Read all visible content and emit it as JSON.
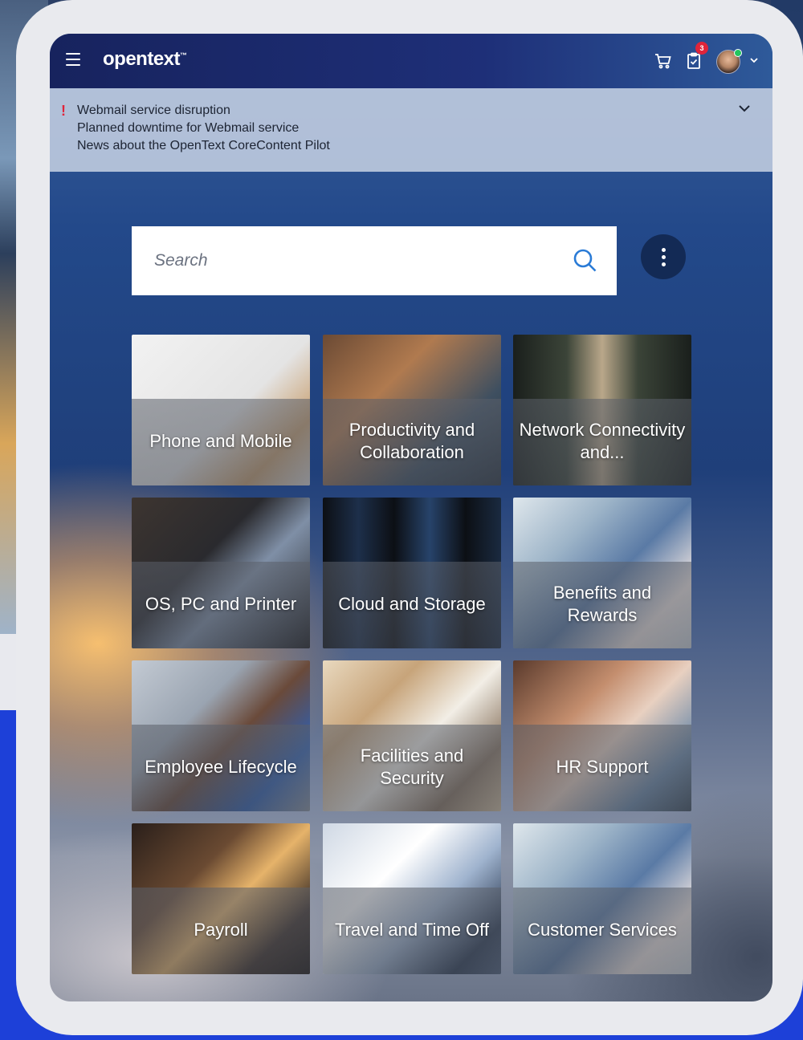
{
  "header": {
    "brand": "opentext",
    "brand_mark": "™",
    "cart_icon": "cart-icon",
    "tasks_icon": "clipboard-check-icon",
    "tasks_badge": "3",
    "user_menu_icon": "chevron-down-icon"
  },
  "notices": {
    "items": [
      "Webmail service disruption",
      "Planned downtime for Webmail service",
      "News about the OpenText CoreContent Pilot"
    ],
    "alert_glyph": "!",
    "colors": {
      "alert": "#e0243a"
    }
  },
  "search": {
    "placeholder": "Search"
  },
  "tiles": [
    {
      "label": "Phone and Mobile"
    },
    {
      "label": "Productivity and Collaboration"
    },
    {
      "label": "Network Connectivity and..."
    },
    {
      "label": "OS, PC and Printer"
    },
    {
      "label": "Cloud and Storage"
    },
    {
      "label": "Benefits and Rewards"
    },
    {
      "label": "Employee Lifecycle"
    },
    {
      "label": "Facilities and Security"
    },
    {
      "label": "HR Support"
    },
    {
      "label": "Payroll"
    },
    {
      "label": "Travel and Time Off"
    },
    {
      "label": "Customer Services"
    }
  ],
  "colors": {
    "topbar": "#17235e",
    "badge": "#e0243a",
    "more_button": "#132a55",
    "page_accent": "#1d40d8"
  }
}
